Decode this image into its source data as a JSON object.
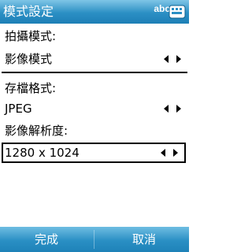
{
  "titlebar": {
    "title": "模式設定",
    "input_mode": "abc",
    "keyboard_icon": "keyboard-icon"
  },
  "form": {
    "capture_mode": {
      "label": "拍攝模式:",
      "value": "影像模式"
    },
    "storage_format": {
      "label": "存檔格式:",
      "value": "JPEG"
    },
    "resolution": {
      "label": "影像解析度:",
      "value": "1280 x 1024"
    }
  },
  "softkeys": {
    "left": "完成",
    "right": "取消"
  },
  "colors": {
    "bar_top": "#7fc5e6",
    "bar_bottom": "#1d7fb6"
  }
}
